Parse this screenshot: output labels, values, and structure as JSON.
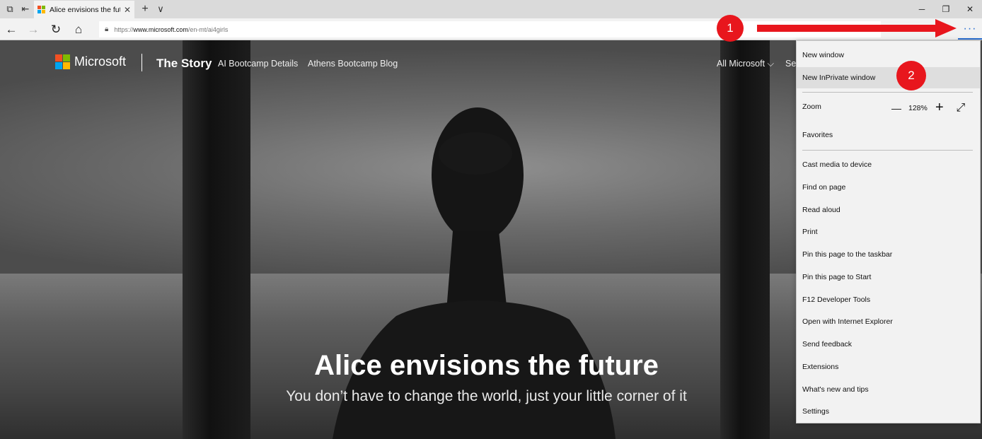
{
  "browser": {
    "tab": {
      "title": "Alice envisions the futur",
      "close": "✕"
    },
    "new_tab": "+",
    "tab_list": "∨",
    "window": {
      "minimize": "─",
      "restore": "❐",
      "close": "✕"
    },
    "nav": {
      "back": "←",
      "forward": "→",
      "refresh": "↻",
      "home": "⌂"
    },
    "address": {
      "prefix": "https://",
      "host": "www.microsoft.com",
      "path": "/en-mt/ai4girls"
    },
    "more_label": "···"
  },
  "site": {
    "brand": "Microsoft",
    "story": "The Story",
    "links": [
      "AI Bootcamp Details",
      "Athens Bootcamp Blog"
    ],
    "all_microsoft": "All Microsoft ⌵",
    "search_partial": "Se"
  },
  "hero": {
    "title": "Alice envisions the future",
    "subtitle": "You don’t have to change the world, just your little corner of it"
  },
  "annotations": {
    "step1": "1",
    "step2": "2",
    "color": "#e8161d"
  },
  "menu": {
    "items": [
      "New window",
      "New InPrivate window",
      "Zoom",
      "Favorites",
      "Cast media to device",
      "Find on page",
      "Read aloud",
      "Print",
      "Pin this page to the taskbar",
      "Pin this page to Start",
      "F12 Developer Tools",
      "Open with Internet Explorer",
      "Send feedback",
      "Extensions",
      "What's new and tips",
      "Settings"
    ],
    "highlighted": "New InPrivate window",
    "zoom": {
      "minus": "—",
      "value": "128%",
      "plus": "+",
      "fullscreen": "⤢"
    }
  },
  "colors": {
    "ms_red": "#f25022",
    "ms_green": "#7fba00",
    "ms_blue": "#00a4ef",
    "ms_yellow": "#ffb900",
    "accent": "#2a6fd1"
  }
}
